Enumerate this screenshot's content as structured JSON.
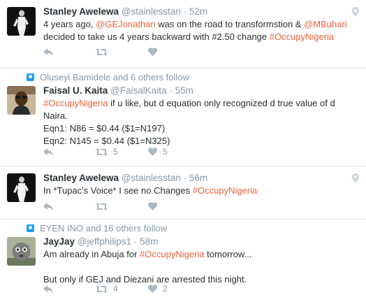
{
  "tweets": [
    {
      "name": "Stanley Awelewa",
      "handle": "@stainlesstan",
      "time": "52m",
      "line1_a": "4 years ago, ",
      "line1_mention1": "@GEJonathan",
      "line1_b": " was on the road to transformstion & ",
      "line1_mention2": "@MBuhari",
      "line2_a": "decided to take us 4 years backward with #2.50 change ",
      "line2_hash": "#OccupyNigeria",
      "retweets": "",
      "likes": ""
    },
    {
      "context": "Oluseyi Bamidele and 6 others follow",
      "name": "Faisal U. Kaita",
      "handle": "@FaisalKaita",
      "time": "55m",
      "line1_hash": "#OccupyNigeria",
      "line1_rest": " if u like, but d equation only recognized d true value of d",
      "line2": "Naira.",
      "line3": "Eqn1: N86 = $0.44 ($1=N197)",
      "line4": "Eqn2: N145 = $0.44 ($1=N325)",
      "retweets": "5",
      "likes": "5"
    },
    {
      "name": "Stanley Awelewa",
      "handle": "@stainlesstan",
      "time": "56m",
      "line1_a": "In *Tupac's Voice* I see no Changes ",
      "line1_hash": "#OccupyNigeria",
      "retweets": "",
      "likes": ""
    },
    {
      "context": "EYEN INO and 16 others follow",
      "name": "JayJay",
      "handle": "@jeffphilips1",
      "time": "58m",
      "line1_a": "Am already in Abuja for ",
      "line1_hash": "#OccupyNigeria",
      "line1_b": " tomorrow...",
      "line2": "But only if GEJ and Diezani are arrested this night.",
      "retweets": "4",
      "likes": "2"
    }
  ],
  "separator": " · ",
  "icons": {
    "reply": "reply-icon",
    "retweet": "retweet-icon",
    "like": "heart-icon",
    "location": "location-pin-icon",
    "context": "follow-context-icon"
  },
  "colors": {
    "hashtag_link": "#e8633a",
    "meta": "#8899a6",
    "divider": "#e1e8ed"
  }
}
